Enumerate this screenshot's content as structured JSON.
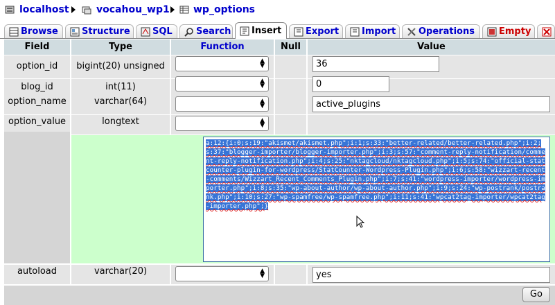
{
  "breadcrumb": {
    "server": "localhost",
    "database": "vocahou_wp1",
    "table": "wp_options"
  },
  "tabs": [
    {
      "label": "Browse",
      "icon": "browse-icon"
    },
    {
      "label": "Structure",
      "icon": "structure-icon"
    },
    {
      "label": "SQL",
      "icon": "sql-icon"
    },
    {
      "label": "Search",
      "icon": "search-icon"
    },
    {
      "label": "Insert",
      "icon": "insert-icon",
      "active": true
    },
    {
      "label": "Export",
      "icon": "export-icon"
    },
    {
      "label": "Import",
      "icon": "import-icon"
    },
    {
      "label": "Operations",
      "icon": "operations-icon"
    },
    {
      "label": "Empty",
      "icon": "empty-icon",
      "danger": true
    }
  ],
  "table_headers": {
    "field": "Field",
    "type": "Type",
    "function": "Function",
    "null": "Null",
    "value": "Value"
  },
  "rows": [
    {
      "field": "option_id",
      "type": "bigint(20) unsigned",
      "value": "36"
    },
    {
      "field": "blog_id",
      "type": "int(11)",
      "value": "0"
    },
    {
      "field": "option_name",
      "type": "varchar(64)",
      "value": "active_plugins"
    },
    {
      "field": "option_value",
      "type": "longtext",
      "value": "a:12:{i:0;s:19:\"akismet/akismet.php\";i:1;s:33:\"better-related/better-related.php\";i:2;s:37:\"blogger-importer/blogger-importer.php\";i:3;s:57:\"comment-reply-notification/comment-reply-notification.php\";i:4;s:25:\"nktagcloud/nktagcloud.php\";i:5;s:74:\"official-statcounter-plugin-for-wordpress/StatCounter-Wordpress-Plugin.php\";i:6;s:58:\"wizzart-recent-comments/Wizzart_Recent_Comments_Plugin.php\";i:7;s:41:\"wordpress-importer/wordpress-importer.php\";i:8;s:35:\"wp-about-author/wp-about-author.php\";i:9;s:24:\"wp-postrank/postrank.php\";i:10;s:27:\"wp-spamfree/wp-spamfree.php\";i:11;s:41:\"wpcat2tag-importer/wpcat2tag-importer.php\";}"
    },
    {
      "field": "autoload",
      "type": "varchar(20)",
      "value": "yes"
    }
  ],
  "go_button": "Go",
  "colors": {
    "link": "#0000cc",
    "header_bg": "#d0dce0",
    "row_bg": "#e5e5e5",
    "edit_bg": "#ccffcc",
    "selection": "#3875d7"
  }
}
